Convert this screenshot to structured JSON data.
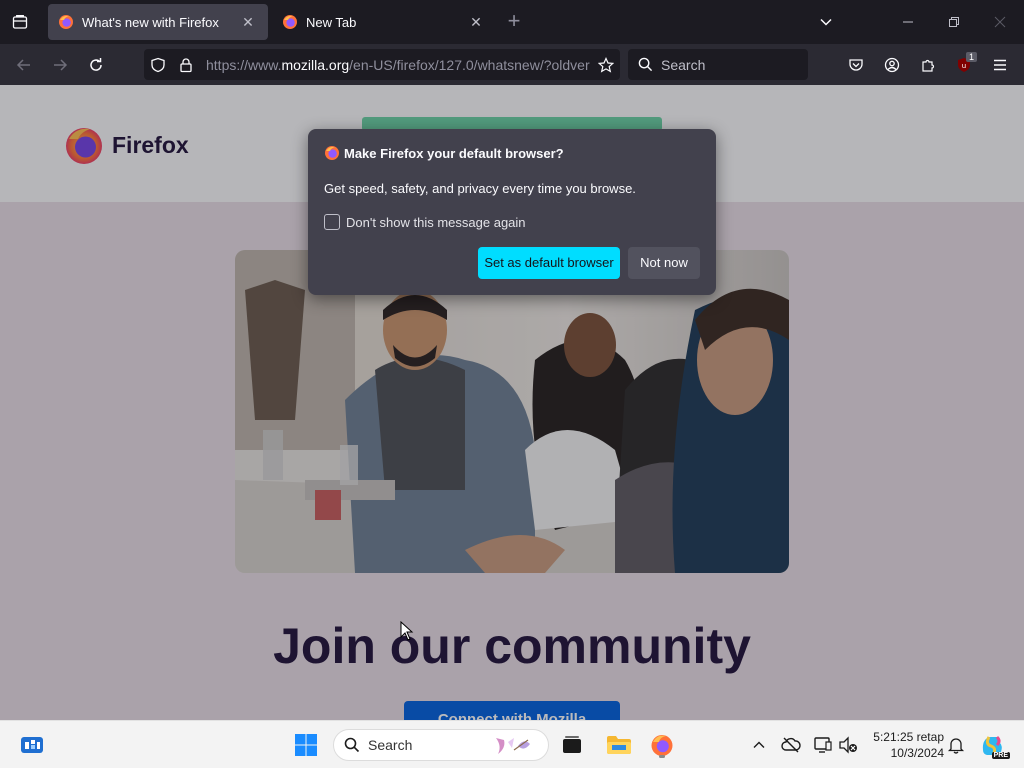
{
  "tabs": [
    {
      "title": "What's new with Firefox",
      "active": true
    },
    {
      "title": "New Tab",
      "active": false
    }
  ],
  "navbar": {
    "url_prefix": "https://www.",
    "url_domain": "mozilla.org",
    "url_rest": "/en-US/firefox/127.0/whatsnew/?oldver",
    "search_placeholder": "Search",
    "extension_badge": "1"
  },
  "page": {
    "brand": "Firefox",
    "headline": "Join our community",
    "cta_label": "Connect with Mozilla"
  },
  "dialog": {
    "title": "Make Firefox your default browser?",
    "body": "Get speed, safety, and privacy every time you browse.",
    "checkbox_label": "Don't show this message again",
    "checkbox_checked": false,
    "primary_button": "Set as default browser",
    "secondary_button": "Not now"
  },
  "taskbar": {
    "search_placeholder": "Search",
    "time": "5:21:25 retap",
    "date": "10/3/2024",
    "copilot_badge": "PRE"
  },
  "colors": {
    "accent": "#00ddff",
    "toolbar": "#2b2a33",
    "tabstrip": "#1c1b22",
    "dialog": "#42414d",
    "page_bg": "#e8dde5",
    "headline": "#20123a"
  }
}
